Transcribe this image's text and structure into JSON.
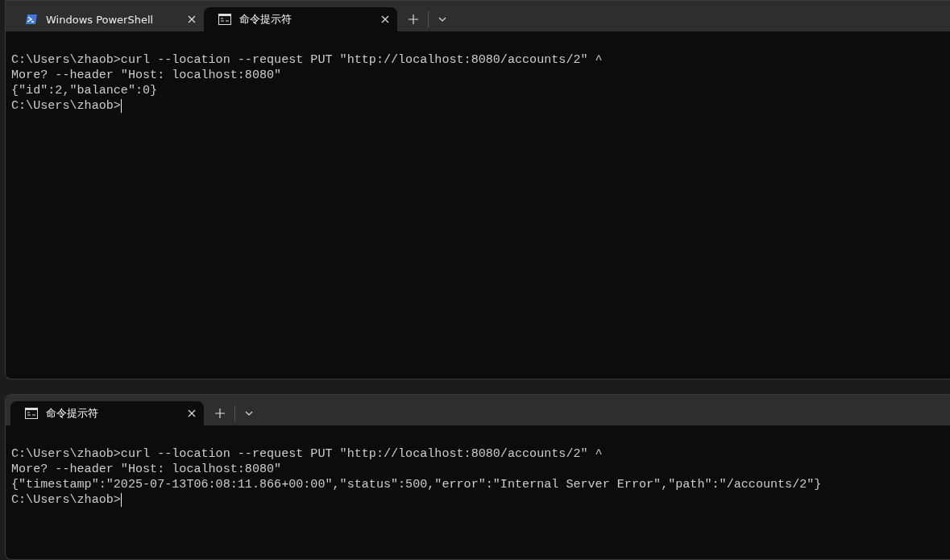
{
  "windows": [
    {
      "tabs": [
        {
          "label": "Windows PowerShell",
          "kind": "powershell",
          "selected": false
        },
        {
          "label": "命令提示符",
          "kind": "cmd",
          "selected": true
        }
      ],
      "lines": [
        "C:\\Users\\zhaob>curl --location --request PUT \"http://localhost:8080/accounts/2\" ^",
        "More? --header \"Host: localhost:8080\"",
        "{\"id\":2,\"balance\":0}",
        "C:\\Users\\zhaob>"
      ],
      "cursor": true
    },
    {
      "tabs": [
        {
          "label": "命令提示符",
          "kind": "cmd",
          "selected": true
        }
      ],
      "lines": [
        "C:\\Users\\zhaob>curl --location --request PUT \"http://localhost:8080/accounts/2\" ^",
        "More? --header \"Host: localhost:8080\"",
        "{\"timestamp\":\"2025-07-13T06:08:11.866+00:00\",\"status\":500,\"error\":\"Internal Server Error\",\"path\":\"/accounts/2\"}",
        "C:\\Users\\zhaob>"
      ],
      "cursor": true
    }
  ]
}
